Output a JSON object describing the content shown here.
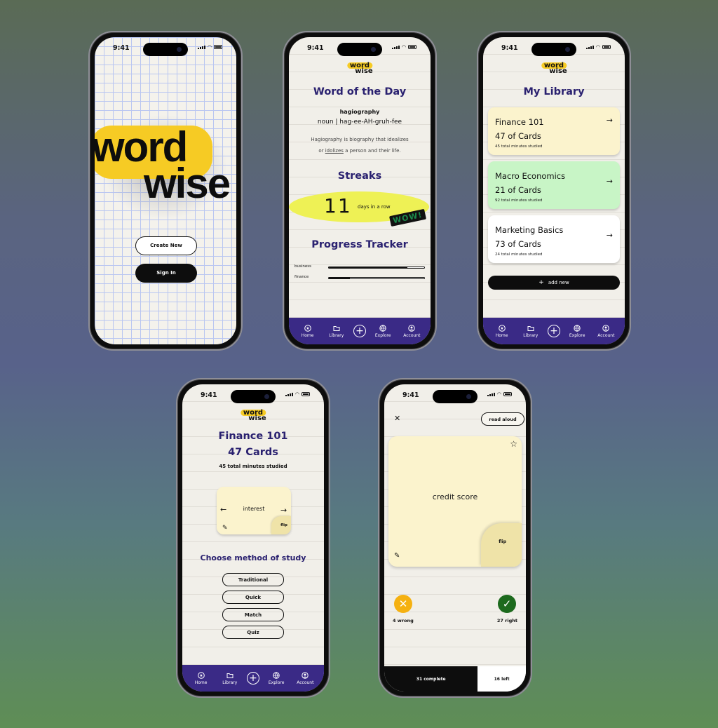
{
  "status": {
    "time": "9:41"
  },
  "logo": {
    "word": "word",
    "wise": "wise"
  },
  "splash": {
    "create_new": "Create New",
    "sign_in": "Sign In"
  },
  "nav": {
    "home": "Home",
    "library": "Library",
    "add": "+",
    "explore": "Explore",
    "account": "Account"
  },
  "home": {
    "wotd_title": "Word of the Day",
    "word": "hagiography",
    "pronunciation": "noun | hag-ee-AH-gruh-fee",
    "definition_a": "Hagiography is biography that idealizes",
    "definition_b_pre": "or ",
    "definition_b_link": "idolizes",
    "definition_b_post": " a person and their life.",
    "streaks_title": "Streaks",
    "streak_count": "11",
    "streak_label": "days in a row",
    "wow": "WOW!",
    "progress_title": "Progress Tracker",
    "progress": [
      {
        "label": "business",
        "value": 0.82
      },
      {
        "label": "finance",
        "value": 0.22
      }
    ]
  },
  "library": {
    "title": "My Library",
    "decks": [
      {
        "name": "Finance 101",
        "cards": "47 of Cards",
        "minutes": "45 total minutes studied",
        "color": "#fbf3cd"
      },
      {
        "name": "Macro Economics",
        "cards": "21 of Cards",
        "minutes": "92 total minutes studied",
        "color": "#c8f5c6"
      },
      {
        "name": "Marketing Basics",
        "cards": "73 of Cards",
        "minutes": "24 total minutes studied",
        "color": "#ffffff"
      }
    ],
    "add_new": "add new"
  },
  "deck": {
    "title": "Finance 101",
    "cards": "47 Cards",
    "minutes": "45 total minutes studied",
    "card_word": "interest",
    "flip": "flip",
    "choose_title": "Choose method of study",
    "methods": [
      "Traditional",
      "Quick",
      "Match",
      "Quiz"
    ]
  },
  "study": {
    "read_aloud": "read aloud",
    "term": "credit score",
    "flip": "flip",
    "wrong": "4 wrong",
    "right": "27 right",
    "complete": "31 complete",
    "left": "16 left",
    "progress_fraction": 0.66
  },
  "colors": {
    "accent": "#3a2a86",
    "brand_yellow": "#f6cb24",
    "card_yellow": "#fbf3cd",
    "streak_yellow": "#eef155",
    "wrong": "#f5b111",
    "right": "#1d6a1d"
  }
}
